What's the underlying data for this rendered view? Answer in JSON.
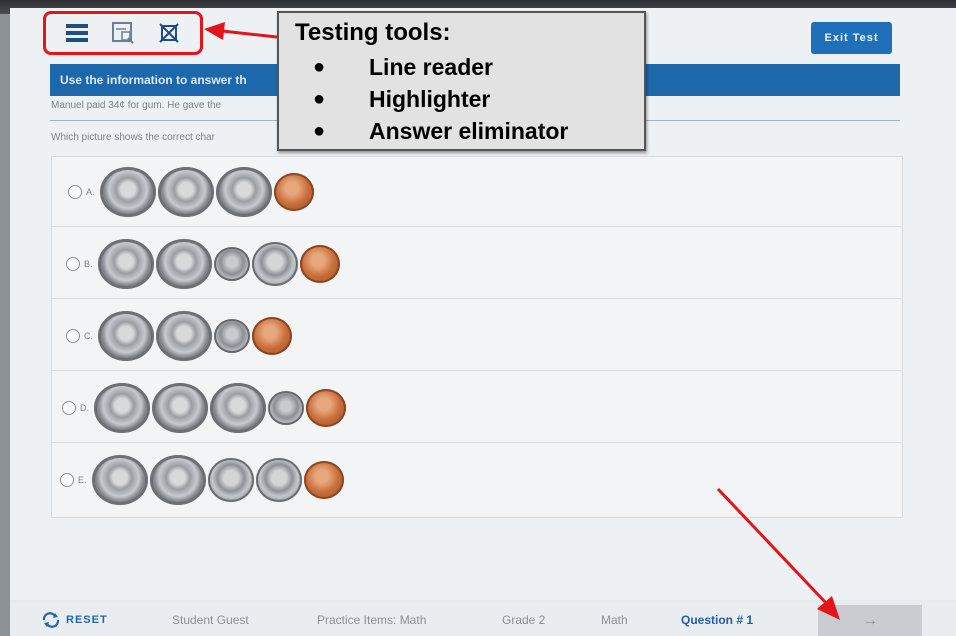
{
  "toolbar": {
    "tools": [
      {
        "name": "line-reader-icon"
      },
      {
        "name": "highlighter-icon"
      },
      {
        "name": "answer-eliminator-icon"
      }
    ],
    "exit_label": "Exit Test"
  },
  "passage": {
    "banner": "Use the information to answer th",
    "stem": "Manuel paid 34¢ for gum. He gave the",
    "question": "Which picture shows the correct char"
  },
  "answers": [
    {
      "letter": "A.",
      "coins": [
        "quarter",
        "quarter",
        "quarter",
        "penny"
      ]
    },
    {
      "letter": "B.",
      "coins": [
        "quarter",
        "quarter",
        "dime",
        "nickel",
        "penny"
      ]
    },
    {
      "letter": "C.",
      "coins": [
        "quarter",
        "quarter",
        "dime",
        "penny"
      ]
    },
    {
      "letter": "D.",
      "coins": [
        "quarter",
        "quarter",
        "quarter",
        "dime",
        "penny"
      ]
    },
    {
      "letter": "E.",
      "coins": [
        "quarter",
        "quarter",
        "nickel",
        "nickel",
        "penny"
      ]
    }
  ],
  "callout": {
    "title": "Testing tools:",
    "items": [
      "Line reader",
      "Highlighter",
      "Answer eliminator"
    ]
  },
  "footer": {
    "reset": "RESET",
    "student": "Student Guest",
    "test": "Practice Items: Math",
    "grade": "Grade 2",
    "subject": "Math",
    "question": "Question # 1",
    "next_icon": "→"
  },
  "colors": {
    "accent": "#1d68ab",
    "annotation": "#e3141b"
  }
}
